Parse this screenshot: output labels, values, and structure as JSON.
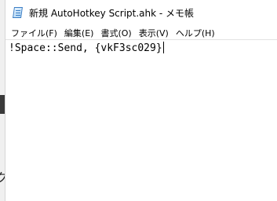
{
  "window": {
    "title": "新規 AutoHotkey Script.ahk - メモ帳",
    "app_icon": "notepad-icon"
  },
  "menubar": {
    "items": [
      {
        "label": "ファイル(F)"
      },
      {
        "label": "編集(E)"
      },
      {
        "label": "書式(O)"
      },
      {
        "label": "表示(V)"
      },
      {
        "label": "ヘルプ(H)"
      }
    ]
  },
  "editor": {
    "text": "!Space::Send, {vkF3sc029}"
  },
  "background": {
    "partial_glyph": "ク"
  }
}
